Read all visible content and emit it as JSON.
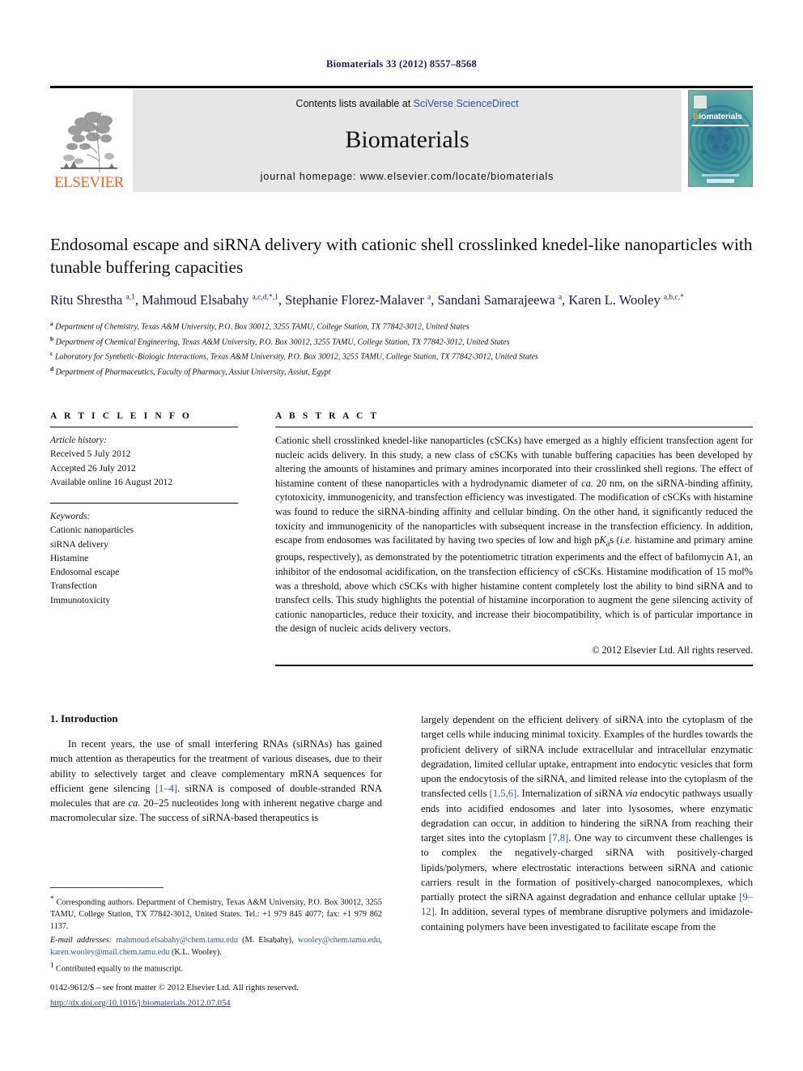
{
  "running_head": "Biomaterials 33 (2012) 8557–8568",
  "masthead": {
    "publisher_name": "ELSEVIER",
    "contents_prefix": "Contents lists available at ",
    "contents_link": "SciVerse ScienceDirect",
    "journal_name": "Biomaterials",
    "homepage": "journal homepage: www.elsevier.com/locate/biomaterials",
    "cover": {
      "title_first": "B",
      "title_rest": "iomaterials"
    }
  },
  "article": {
    "title": "Endosomal escape and siRNA delivery with cationic shell crosslinked knedel-like nanoparticles with tunable buffering capacities",
    "authors_html": "Ritu Shrestha <sup>a,1</sup>, Mahmoud Elsabahy <sup>a,c,d,*,1</sup>, Stephanie Florez-Malaver <sup>a</sup>, Sandani Samarajeewa <sup>a</sup>, Karen L. Wooley <sup>a,b,c,*</sup>",
    "affiliations": [
      {
        "mark": "a",
        "text": "Department of Chemistry, Texas A&M University, P.O. Box 30012, 3255 TAMU, College Station, TX 77842-3012, United States"
      },
      {
        "mark": "b",
        "text": "Department of Chemical Engineering, Texas A&M University, P.O. Box 30012, 3255 TAMU, College Station, TX 77842-3012, United States"
      },
      {
        "mark": "c",
        "text": "Laboratory for Synthetic-Biologic Interactions, Texas A&M University, P.O. Box 30012, 3255 TAMU, College Station, TX 77842-3012, United States"
      },
      {
        "mark": "d",
        "text": "Department of Pharmaceutics, Faculty of Pharmacy, Assiut University, Assiut, Egypt"
      }
    ]
  },
  "article_info": {
    "heading": "A R T I C L E   I N F O",
    "history_label": "Article history:",
    "history": [
      "Received 5 July 2012",
      "Accepted 26 July 2012",
      "Available online 16 August 2012"
    ],
    "keywords_label": "Keywords:",
    "keywords": [
      "Cationic nanoparticles",
      "siRNA delivery",
      "Histamine",
      "Endosomal escape",
      "Transfection",
      "Immunotoxicity"
    ]
  },
  "abstract": {
    "heading": "A B S T R A C T",
    "body_html": "Cationic shell crosslinked knedel-like nanoparticles (cSCKs) have emerged as a highly efficient transfection agent for nucleic acids delivery. In this study, a new class of cSCKs with tunable buffering capacities has been developed by altering the amounts of histamines and primary amines incorporated into their crosslinked shell regions. The effect of histamine content of these nanoparticles with a hydrodynamic diameter of <em>ca.</em> 20 nm, on the siRNA-binding affinity, cytotoxicity, immunogenicity, and transfection efficiency was investigated. The modification of cSCKs with histamine was found to reduce the siRNA-binding affinity and cellular binding. On the other hand, it significantly reduced the toxicity and immunogenicity of the nanoparticles with subsequent increase in the transfection efficiency. In addition, escape from endosomes was facilitated by having two species of low and high p<em>K</em><sub>a</sub>s (<em>i.e.</em> histamine and primary amine groups, respectively), as demonstrated by the potentiometric titration experiments and the effect of bafilomycin A1, an inhibitor of the endosomal acidification, on the transfection efficiency of cSCKs. Histamine modification of 15 mol% was a threshold, above which cSCKs with higher histamine content completely lost the ability to bind siRNA and to transfect cells. This study highlights the potential of histamine incorporation to augment the gene silencing activity of cationic nanoparticles, reduce their toxicity, and increase their biocompatibility, which is of particular importance in the design of nucleic acids delivery vectors.",
    "copyright": "© 2012 Elsevier Ltd. All rights reserved."
  },
  "introduction": {
    "heading": "1.  Introduction",
    "left_html": "In recent years, the use of small interfering RNAs (siRNAs) has gained much attention as therapeutics for the treatment of various diseases, due to their ability to selectively target and cleave complementary mRNA sequences for efficient gene silencing <a class=\"ref\" href=\"#\">[1–4]</a>. siRNA is composed of double-stranded RNA molecules that are <em>ca.</em> 20–25 nucleotides long with inherent negative charge and macromolecular size. The success of siRNA-based therapeutics is",
    "right_html": "largely dependent on the efficient delivery of siRNA into the cytoplasm of the target cells while inducing minimal toxicity. Examples of the hurdles towards the proficient delivery of siRNA include extracellular and intracellular enzymatic degradation, limited cellular uptake, entrapment into endocytic vesicles that form upon the endocytosis of the siRNA, and limited release into the cytoplasm of the transfected cells <a class=\"ref\" href=\"#\">[1,5,6]</a>. Internalization of siRNA <em>via</em> endocytic pathways usually ends into acidified endosomes and later into lysosomes, where enzymatic degradation can occur, in addition to hindering the siRNA from reaching their target sites into the cytoplasm <a class=\"ref\" href=\"#\">[7,8]</a>. One way to circumvent these challenges is to complex the negatively-charged siRNA with positively-charged lipids/polymers, where electrostatic interactions between siRNA and cationic carriers result in the formation of positively-charged nanocomplexes, which partially protect the siRNA against degradation and enhance cellular uptake <a class=\"ref\" href=\"#\">[9–12]</a>. In addition, several types of membrane disruptive polymers and imidazole-containing polymers have been investigated to facilitate escape from the"
  },
  "footnotes": {
    "corresponding_html": "<span class=\"fn-mark\">*</span> Corresponding authors. Department of Chemistry, Texas A&amp;M University, P.O. Box 30012, 3255 TAMU, College Station, TX 77842-3012, United States. Tel.: +1 979 845 4077; fax: +1 979 862 1137.",
    "email_html": "<em>E-mail addresses:</em> <a class=\"mail\" href=\"#\">mahmoud.elsabahy@chem.tamu.edu</a> (M. Elsabahy), <a class=\"mail\" href=\"#\">wooley@chem.tamu.edu</a>, <a class=\"mail\" href=\"#\">karen.wooley@mail.chem.tamu.edu</a> (K.L. Wooley).",
    "contributed_html": "<span class=\"fn-mark\">1</span> Contributed equally to the manuscript."
  },
  "imprint": {
    "line": "0142-9612/$ – see front matter © 2012 Elsevier Ltd. All rights reserved.",
    "doi": "http://dx.doi.org/10.1016/j.biomaterials.2012.07.054"
  },
  "colors": {
    "elsevier_orange": "#f26522",
    "link_blue": "#2b55a8",
    "author_navy": "#1a1a5e",
    "cover_teal": "#3f9aa0"
  }
}
